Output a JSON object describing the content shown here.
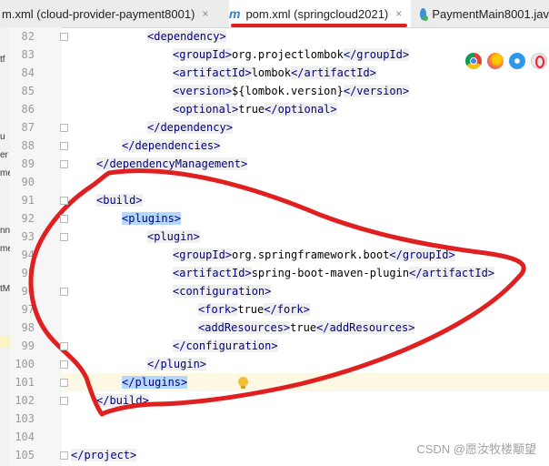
{
  "tabs": [
    {
      "label": "m.xml (cloud-provider-payment8001)",
      "close": "×",
      "icon": "maven-file-icon",
      "active": false
    },
    {
      "label": "pom.xml (springcloud2021)",
      "close": "×",
      "icon": "maven-m-icon",
      "icon_glyph": "m",
      "active": true
    },
    {
      "label": "PaymentMain8001.jav",
      "close": "",
      "icon": "java-class-icon",
      "active": false
    }
  ],
  "left_strip": [
    "tf",
    "u",
    "er",
    "me",
    "nn",
    "me",
    "tM"
  ],
  "editor": {
    "lines": [
      {
        "num": "82",
        "indent": 3,
        "parts": [
          {
            "t": "tag",
            "v": "<dependency>"
          }
        ]
      },
      {
        "num": "83",
        "indent": 4,
        "parts": [
          {
            "t": "tag",
            "v": "<groupId>"
          },
          {
            "t": "val",
            "v": "org.projectlombok"
          },
          {
            "t": "tag",
            "v": "</groupId>"
          }
        ]
      },
      {
        "num": "84",
        "indent": 4,
        "parts": [
          {
            "t": "tag",
            "v": "<artifactId>"
          },
          {
            "t": "val",
            "v": "lombok"
          },
          {
            "t": "tag",
            "v": "</artifactId>"
          }
        ]
      },
      {
        "num": "85",
        "indent": 4,
        "parts": [
          {
            "t": "tag",
            "v": "<version>"
          },
          {
            "t": "val",
            "v": "${lombok.version}"
          },
          {
            "t": "tag",
            "v": "</version>"
          }
        ]
      },
      {
        "num": "86",
        "indent": 4,
        "parts": [
          {
            "t": "tag",
            "v": "<optional>"
          },
          {
            "t": "val",
            "v": "true"
          },
          {
            "t": "tag",
            "v": "</optional>"
          }
        ]
      },
      {
        "num": "87",
        "indent": 3,
        "parts": [
          {
            "t": "tag",
            "v": "</dependency>"
          }
        ]
      },
      {
        "num": "88",
        "indent": 2,
        "parts": [
          {
            "t": "tag",
            "v": "</dependencies>"
          }
        ]
      },
      {
        "num": "89",
        "indent": 1,
        "parts": [
          {
            "t": "tag",
            "v": "</dependencyManagement>"
          }
        ]
      },
      {
        "num": "90",
        "indent": 0,
        "parts": []
      },
      {
        "num": "91",
        "indent": 1,
        "parts": [
          {
            "t": "tag",
            "v": "<build>"
          }
        ]
      },
      {
        "num": "92",
        "indent": 2,
        "parts": [
          {
            "t": "sel",
            "v": "<plugins>"
          }
        ]
      },
      {
        "num": "93",
        "indent": 3,
        "parts": [
          {
            "t": "tag",
            "v": "<plugin>"
          }
        ]
      },
      {
        "num": "94",
        "indent": 4,
        "parts": [
          {
            "t": "tag",
            "v": "<groupId>"
          },
          {
            "t": "val",
            "v": "org.springframework.boot"
          },
          {
            "t": "tag",
            "v": "</groupId>"
          }
        ]
      },
      {
        "num": "95",
        "indent": 4,
        "parts": [
          {
            "t": "tag",
            "v": "<artifactId>"
          },
          {
            "t": "val",
            "v": "spring-boot-maven-plugin"
          },
          {
            "t": "tag",
            "v": "</artifactId>"
          }
        ]
      },
      {
        "num": "96",
        "indent": 4,
        "parts": [
          {
            "t": "tag",
            "v": "<configuration>"
          }
        ]
      },
      {
        "num": "97",
        "indent": 5,
        "parts": [
          {
            "t": "tag",
            "v": "<fork>"
          },
          {
            "t": "val",
            "v": "true"
          },
          {
            "t": "tag",
            "v": "</fork>"
          }
        ]
      },
      {
        "num": "98",
        "indent": 5,
        "parts": [
          {
            "t": "tag",
            "v": "<addResources>"
          },
          {
            "t": "val",
            "v": "true"
          },
          {
            "t": "tag",
            "v": "</addResources>"
          }
        ]
      },
      {
        "num": "99",
        "indent": 4,
        "parts": [
          {
            "t": "tag",
            "v": "</configuration>"
          }
        ]
      },
      {
        "num": "100",
        "indent": 3,
        "parts": [
          {
            "t": "tag",
            "v": "</plugin>"
          }
        ]
      },
      {
        "num": "101",
        "indent": 2,
        "parts": [
          {
            "t": "sel",
            "v": "</plugins>"
          }
        ],
        "highlight": true
      },
      {
        "num": "102",
        "indent": 1,
        "parts": [
          {
            "t": "tag",
            "v": "</build>"
          }
        ]
      },
      {
        "num": "103",
        "indent": 0,
        "parts": []
      },
      {
        "num": "104",
        "indent": 0,
        "parts": []
      },
      {
        "num": "105",
        "indent": 0,
        "parts": [
          {
            "t": "tag",
            "v": "</project>"
          }
        ]
      }
    ]
  },
  "browser_icons": [
    "chrome-icon",
    "firefox-icon",
    "safari-icon",
    "opera-icon",
    "ie-icon"
  ],
  "watermark": "CSDN @愿汝牧楼颙望",
  "colors": {
    "tag": "#000080",
    "tag_bg": "#efefef",
    "selection": "#b4d7ff",
    "annotation": "#e02020",
    "current_line": "#fdf8e4"
  }
}
